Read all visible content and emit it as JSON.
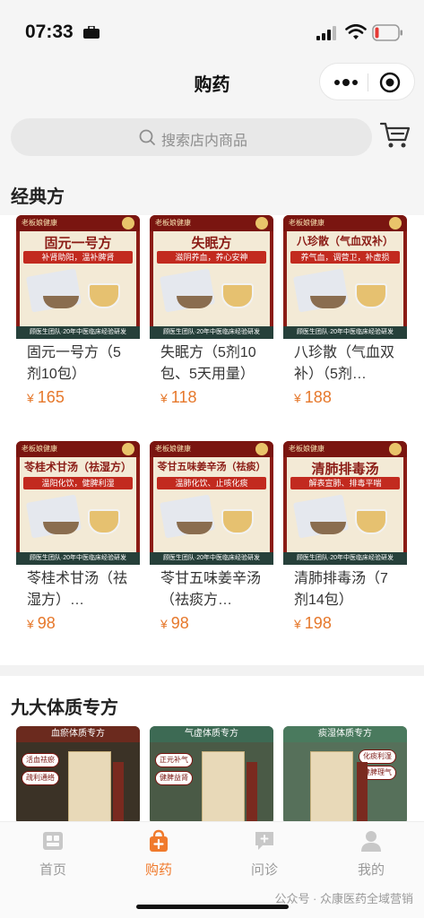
{
  "status_bar": {
    "time": "07:33"
  },
  "nav": {
    "title": "购药"
  },
  "search": {
    "placeholder": "搜索店内商品"
  },
  "sections": {
    "classic": {
      "title": "经典方"
    },
    "constitution": {
      "title": "九大体质专方"
    }
  },
  "product_image": {
    "brand": "老板娘健康",
    "footer": "顾医生团队·20年中医临床经验研发"
  },
  "products": [
    {
      "name": "固元一号方（5剂10包）",
      "price": "165",
      "img_title": "固元一号方",
      "img_sub": "补肾助阳，温补脾肾"
    },
    {
      "name": "失眠方（5剂10包、5天用量）",
      "price": "118",
      "img_title": "失眠方",
      "img_sub": "滋阴养血，养心安神"
    },
    {
      "name": "八珍散（气血双补）（5剂…",
      "price": "188",
      "img_title": "八珍散（气血双补）",
      "img_sub": "养气血，调营卫，补虚损"
    },
    {
      "name": "苓桂术甘汤（祛湿方）…",
      "price": "98",
      "img_title": "苓桂术甘汤（祛湿方）",
      "img_sub": "温阳化饮，健脾利湿"
    },
    {
      "name": "苓甘五味姜辛汤（祛痰方…",
      "price": "98",
      "img_title": "苓甘五味姜辛汤（祛痰）",
      "img_sub": "温肺化饮、止咳化痰"
    },
    {
      "name": "清肺排毒汤（7剂14包）",
      "price": "198",
      "img_title": "清肺排毒汤",
      "img_sub": "解表宣肺、排毒平喘"
    }
  ],
  "currency": "¥",
  "constitution_cards": [
    {
      "header": "血瘀体质专方",
      "tags": [
        "活血祛瘀",
        "疏利通络"
      ]
    },
    {
      "header": "气虚体质专方",
      "tags": [
        "正元补气",
        "健脾益肾"
      ]
    },
    {
      "header": "痰湿体质专方",
      "tags": [
        "化痰利湿",
        "健脾理气"
      ]
    }
  ],
  "tabs": [
    {
      "label": "首页",
      "icon": "home-icon"
    },
    {
      "label": "购药",
      "icon": "shopping-bag-icon"
    },
    {
      "label": "问诊",
      "icon": "chat-icon"
    },
    {
      "label": "我的",
      "icon": "user-icon"
    }
  ],
  "watermark": "公众号 · 众康医药全域营销",
  "colors": {
    "accent": "#f07a2c",
    "price": "#e6782b",
    "product_red": "#8b1c16"
  }
}
